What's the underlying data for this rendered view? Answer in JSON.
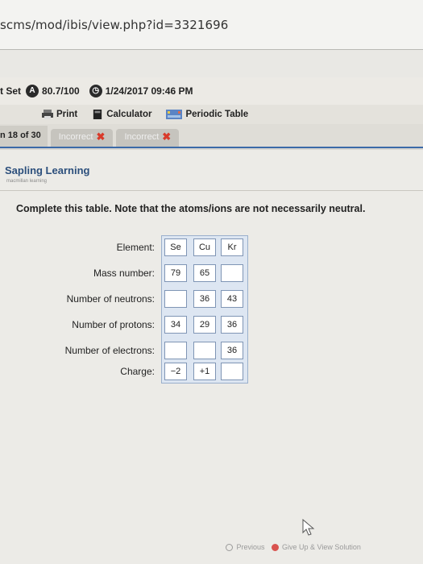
{
  "browser": {
    "url": "scms/mod/ibis/view.php?id=3321696"
  },
  "set_bar": {
    "label": "t Set",
    "score": "80.7/100",
    "date": "1/24/2017 09:46 PM"
  },
  "toolbar": {
    "print_label": "Print",
    "calculator_label": "Calculator",
    "periodic_label": "Periodic Table"
  },
  "tabs": {
    "count_label": "n 18 of 30",
    "items": [
      {
        "label": "Incorrect"
      },
      {
        "label": "Incorrect"
      }
    ]
  },
  "brand": {
    "name": "Sapling Learning",
    "sub": "macmillan learning"
  },
  "question": {
    "prompt": "Complete this table. Note that the atoms/ions are not necessarily neutral."
  },
  "table": {
    "row_labels": [
      "Element:",
      "Mass number:",
      "Number of neutrons:",
      "Number of protons:",
      "Number of electrons:",
      "Charge:"
    ],
    "elements": [
      "Se",
      "Cu",
      "Kr"
    ],
    "mass_number": [
      "79",
      "65",
      ""
    ],
    "neutrons": [
      "",
      "36",
      "43"
    ],
    "protons": [
      "34",
      "29",
      "36"
    ],
    "electrons": [
      "",
      "",
      "36"
    ],
    "charge": [
      "−2",
      "+1",
      ""
    ]
  },
  "footer": {
    "previous": "Previous",
    "give_up": "Give Up & View Solution"
  }
}
